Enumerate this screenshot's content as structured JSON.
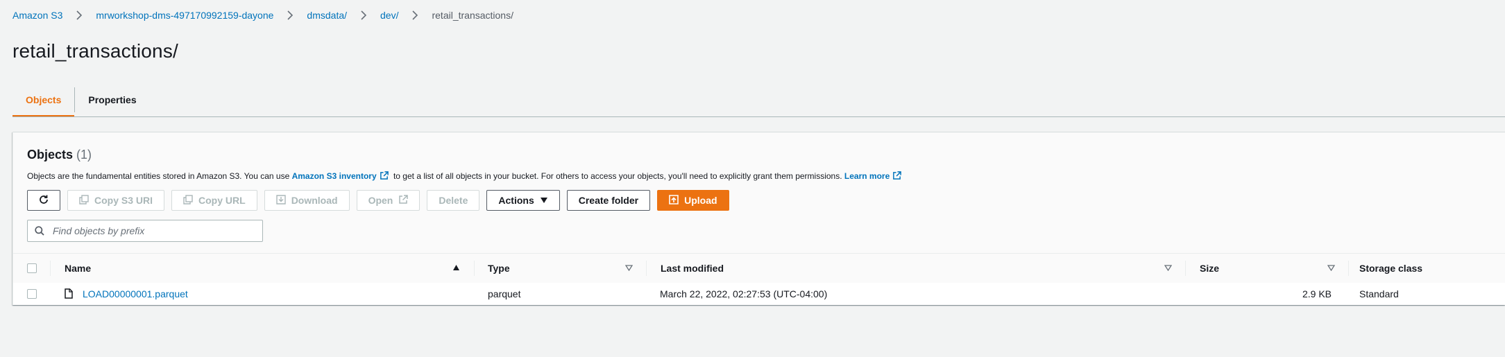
{
  "breadcrumb": {
    "items": [
      "Amazon S3",
      "mrworkshop-dms-497170992159-dayone",
      "dmsdata/",
      "dev/"
    ],
    "current": "retail_transactions/"
  },
  "page": {
    "title": "retail_transactions/"
  },
  "tabs": [
    {
      "label": "Objects",
      "active": true
    },
    {
      "label": "Properties",
      "active": false
    }
  ],
  "objects_panel": {
    "title": "Objects",
    "count": "(1)",
    "desc_part1": "Objects are the fundamental entities stored in Amazon S3. You can use",
    "inventory_link": "Amazon S3 inventory",
    "desc_part2": "to get a list of all objects in your bucket. For others to access your objects, you'll need to explicitly grant them permissions.",
    "learn_more": "Learn more"
  },
  "toolbar": {
    "copy_s3_uri": "Copy S3 URI",
    "copy_url": "Copy URL",
    "download": "Download",
    "open": "Open",
    "delete": "Delete",
    "actions": "Actions",
    "create_folder": "Create folder",
    "upload": "Upload"
  },
  "search": {
    "placeholder": "Find objects by prefix"
  },
  "table": {
    "columns": [
      "Name",
      "Type",
      "Last modified",
      "Size",
      "Storage class"
    ],
    "rows": [
      {
        "name": "LOAD00000001.parquet",
        "type": "parquet",
        "last_modified": "March 22, 2022, 02:27:53 (UTC-04:00)",
        "size": "2.9 KB",
        "storage_class": "Standard"
      }
    ]
  },
  "colors": {
    "accent": "#ec7211",
    "link": "#0073bb",
    "text": "#16191f",
    "disabled": "#aab7b8",
    "background": "#f2f3f3"
  },
  "icons": [
    "chevron-right-icon",
    "refresh-icon",
    "copy-icon",
    "download-icon",
    "external-link-icon",
    "caret-down-icon",
    "upload-icon",
    "search-icon",
    "sort-ascending-icon",
    "sort-icon",
    "file-icon"
  ]
}
